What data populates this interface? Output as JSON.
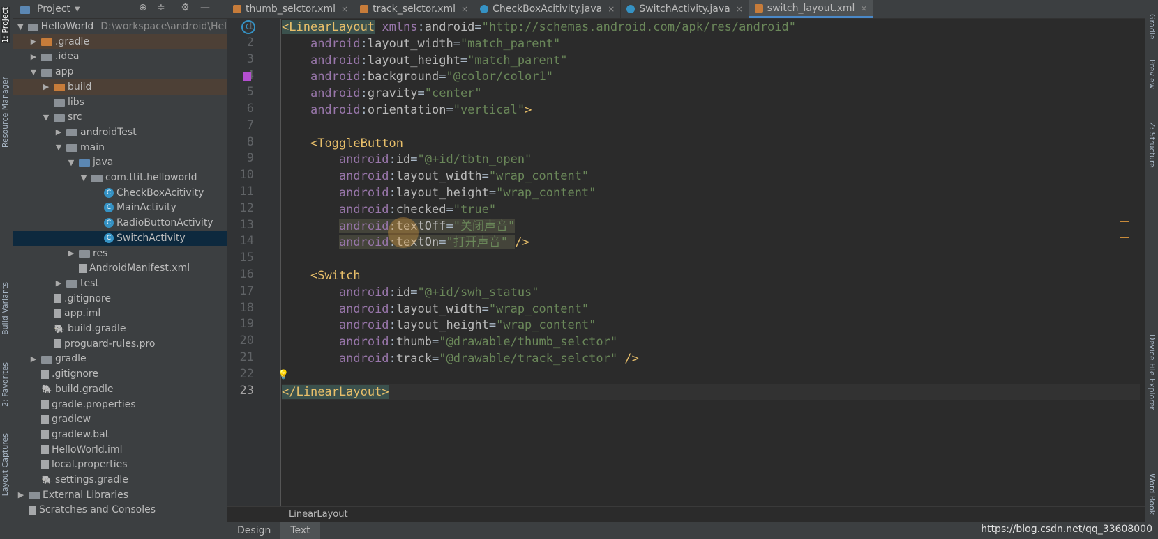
{
  "left_toolbar": [
    "1: Project",
    "Resource Manager",
    "Build Variants",
    "2: Favorites",
    "Layout Captures"
  ],
  "right_toolbar": [
    "Gradle",
    "Preview",
    "Z: Structure",
    "Device File Explorer",
    "Word Book"
  ],
  "project_panel": {
    "title": "Project",
    "tree": [
      {
        "label": "HelloWorld",
        "extra": "D:\\workspace\\android\\Hel",
        "depth": 0,
        "arrow": "down",
        "icon": "module-folder-icon"
      },
      {
        "label": ".gradle",
        "depth": 1,
        "arrow": "right",
        "icon": "folder-icon",
        "state": "excluded"
      },
      {
        "label": ".idea",
        "depth": 1,
        "arrow": "right",
        "icon": "folder-icon"
      },
      {
        "label": "app",
        "depth": 1,
        "arrow": "down",
        "icon": "module-folder-icon"
      },
      {
        "label": "build",
        "depth": 2,
        "arrow": "right",
        "icon": "folder-icon",
        "state": "excluded"
      },
      {
        "label": "libs",
        "depth": 2,
        "arrow": "",
        "icon": "folder-icon"
      },
      {
        "label": "src",
        "depth": 2,
        "arrow": "down",
        "icon": "folder-icon"
      },
      {
        "label": "androidTest",
        "depth": 3,
        "arrow": "right",
        "icon": "folder-icon"
      },
      {
        "label": "main",
        "depth": 3,
        "arrow": "down",
        "icon": "folder-icon"
      },
      {
        "label": "java",
        "depth": 4,
        "arrow": "down",
        "icon": "source-folder-icon"
      },
      {
        "label": "com.ttit.helloworld",
        "depth": 5,
        "arrow": "down",
        "icon": "package-icon"
      },
      {
        "label": "CheckBoxAcitivity",
        "depth": 6,
        "arrow": "",
        "icon": "class-icon"
      },
      {
        "label": "MainActivity",
        "depth": 6,
        "arrow": "",
        "icon": "class-icon"
      },
      {
        "label": "RadioButtonActivity",
        "depth": 6,
        "arrow": "",
        "icon": "class-icon"
      },
      {
        "label": "SwitchActivity",
        "depth": 6,
        "arrow": "",
        "icon": "class-icon",
        "state": "selected"
      },
      {
        "label": "res",
        "depth": 4,
        "arrow": "right",
        "icon": "resource-folder-icon"
      },
      {
        "label": "AndroidManifest.xml",
        "depth": 4,
        "arrow": "",
        "icon": "manifest-file-icon"
      },
      {
        "label": "test",
        "depth": 3,
        "arrow": "right",
        "icon": "folder-icon"
      },
      {
        "label": ".gitignore",
        "depth": 2,
        "arrow": "",
        "icon": "text-file-icon"
      },
      {
        "label": "app.iml",
        "depth": 2,
        "arrow": "",
        "icon": "iml-file-icon"
      },
      {
        "label": "build.gradle",
        "depth": 2,
        "arrow": "",
        "icon": "gradle-file-icon"
      },
      {
        "label": "proguard-rules.pro",
        "depth": 2,
        "arrow": "",
        "icon": "text-file-icon"
      },
      {
        "label": "gradle",
        "depth": 1,
        "arrow": "right",
        "icon": "folder-icon"
      },
      {
        "label": ".gitignore",
        "depth": 1,
        "arrow": "",
        "icon": "text-file-icon"
      },
      {
        "label": "build.gradle",
        "depth": 1,
        "arrow": "",
        "icon": "gradle-file-icon"
      },
      {
        "label": "gradle.properties",
        "depth": 1,
        "arrow": "",
        "icon": "properties-file-icon"
      },
      {
        "label": "gradlew",
        "depth": 1,
        "arrow": "",
        "icon": "text-file-icon"
      },
      {
        "label": "gradlew.bat",
        "depth": 1,
        "arrow": "",
        "icon": "text-file-icon"
      },
      {
        "label": "HelloWorld.iml",
        "depth": 1,
        "arrow": "",
        "icon": "iml-file-icon"
      },
      {
        "label": "local.properties",
        "depth": 1,
        "arrow": "",
        "icon": "properties-file-icon"
      },
      {
        "label": "settings.gradle",
        "depth": 1,
        "arrow": "",
        "icon": "gradle-file-icon"
      },
      {
        "label": "External Libraries",
        "depth": 0,
        "arrow": "right",
        "icon": "library-icon"
      },
      {
        "label": "Scratches and Consoles",
        "depth": 0,
        "arrow": "",
        "icon": "scratch-icon"
      }
    ]
  },
  "tabs": [
    {
      "label": "thumb_selctor.xml",
      "icon": "xml-file-icon",
      "color": "#c77c3a",
      "active": false
    },
    {
      "label": "track_selctor.xml",
      "icon": "xml-file-icon",
      "color": "#c77c3a",
      "active": false
    },
    {
      "label": "CheckBoxAcitivity.java",
      "icon": "class-icon",
      "color": "#3592c4",
      "active": false
    },
    {
      "label": "SwitchActivity.java",
      "icon": "class-icon",
      "color": "#3592c4",
      "active": false
    },
    {
      "label": "switch_layout.xml",
      "icon": "xml-file-icon",
      "color": "#c77c3a",
      "active": true
    }
  ],
  "editor": {
    "lines": [
      [
        [
          "punc",
          "<"
        ],
        [
          "tag",
          "LinearLayout"
        ],
        [
          "plain",
          " "
        ],
        [
          "ns",
          "xmlns"
        ],
        [
          "plain",
          ":"
        ],
        [
          "attr",
          "android"
        ],
        [
          "plain",
          "="
        ],
        [
          "str",
          "\"http://schemas.android.com/apk/res/android\""
        ]
      ],
      [
        [
          "plain",
          "    "
        ],
        [
          "ns",
          "android"
        ],
        [
          "plain",
          ":"
        ],
        [
          "attr",
          "layout_width"
        ],
        [
          "plain",
          "="
        ],
        [
          "str",
          "\"match_parent\""
        ]
      ],
      [
        [
          "plain",
          "    "
        ],
        [
          "ns",
          "android"
        ],
        [
          "plain",
          ":"
        ],
        [
          "attr",
          "layout_height"
        ],
        [
          "plain",
          "="
        ],
        [
          "str",
          "\"match_parent\""
        ]
      ],
      [
        [
          "plain",
          "    "
        ],
        [
          "ns",
          "android"
        ],
        [
          "plain",
          ":"
        ],
        [
          "attr",
          "background"
        ],
        [
          "plain",
          "="
        ],
        [
          "str",
          "\"@color/color1\""
        ]
      ],
      [
        [
          "plain",
          "    "
        ],
        [
          "ns",
          "android"
        ],
        [
          "plain",
          ":"
        ],
        [
          "attr",
          "gravity"
        ],
        [
          "plain",
          "="
        ],
        [
          "str",
          "\"center\""
        ]
      ],
      [
        [
          "plain",
          "    "
        ],
        [
          "ns",
          "android"
        ],
        [
          "plain",
          ":"
        ],
        [
          "attr",
          "orientation"
        ],
        [
          "plain",
          "="
        ],
        [
          "str",
          "\"vertical\""
        ],
        [
          "punc",
          ">"
        ]
      ],
      [],
      [
        [
          "plain",
          "    "
        ],
        [
          "punc",
          "<"
        ],
        [
          "tag",
          "ToggleButton"
        ]
      ],
      [
        [
          "plain",
          "        "
        ],
        [
          "ns",
          "android"
        ],
        [
          "plain",
          ":"
        ],
        [
          "attr",
          "id"
        ],
        [
          "plain",
          "="
        ],
        [
          "str",
          "\"@+id/tbtn_open\""
        ]
      ],
      [
        [
          "plain",
          "        "
        ],
        [
          "ns",
          "android"
        ],
        [
          "plain",
          ":"
        ],
        [
          "attr",
          "layout_width"
        ],
        [
          "plain",
          "="
        ],
        [
          "str",
          "\"wrap_content\""
        ]
      ],
      [
        [
          "plain",
          "        "
        ],
        [
          "ns",
          "android"
        ],
        [
          "plain",
          ":"
        ],
        [
          "attr",
          "layout_height"
        ],
        [
          "plain",
          "="
        ],
        [
          "str",
          "\"wrap_content\""
        ]
      ],
      [
        [
          "plain",
          "        "
        ],
        [
          "ns",
          "android"
        ],
        [
          "plain",
          ":"
        ],
        [
          "attr",
          "checked"
        ],
        [
          "plain",
          "="
        ],
        [
          "str",
          "\"true\""
        ]
      ],
      [
        [
          "plain",
          "        "
        ],
        [
          "ns",
          "android"
        ],
        [
          "plain",
          ":"
        ],
        [
          "attr",
          "textOff"
        ],
        [
          "plain",
          "="
        ],
        [
          "str",
          "\"关闭声音\""
        ]
      ],
      [
        [
          "plain",
          "        "
        ],
        [
          "ns",
          "android"
        ],
        [
          "plain",
          ":"
        ],
        [
          "attr",
          "textOn"
        ],
        [
          "plain",
          "="
        ],
        [
          "str",
          "\"打开声音\""
        ],
        [
          "plain",
          " "
        ],
        [
          "punc",
          "/>"
        ]
      ],
      [],
      [
        [
          "plain",
          "    "
        ],
        [
          "punc",
          "<"
        ],
        [
          "tag",
          "Switch"
        ]
      ],
      [
        [
          "plain",
          "        "
        ],
        [
          "ns",
          "android"
        ],
        [
          "plain",
          ":"
        ],
        [
          "attr",
          "id"
        ],
        [
          "plain",
          "="
        ],
        [
          "str",
          "\"@+id/swh_status\""
        ]
      ],
      [
        [
          "plain",
          "        "
        ],
        [
          "ns",
          "android"
        ],
        [
          "plain",
          ":"
        ],
        [
          "attr",
          "layout_width"
        ],
        [
          "plain",
          "="
        ],
        [
          "str",
          "\"wrap_content\""
        ]
      ],
      [
        [
          "plain",
          "        "
        ],
        [
          "ns",
          "android"
        ],
        [
          "plain",
          ":"
        ],
        [
          "attr",
          "layout_height"
        ],
        [
          "plain",
          "="
        ],
        [
          "str",
          "\"wrap_content\""
        ]
      ],
      [
        [
          "plain",
          "        "
        ],
        [
          "ns",
          "android"
        ],
        [
          "plain",
          ":"
        ],
        [
          "attr",
          "thumb"
        ],
        [
          "plain",
          "="
        ],
        [
          "str",
          "\"@drawable/thumb_selctor\""
        ]
      ],
      [
        [
          "plain",
          "        "
        ],
        [
          "ns",
          "android"
        ],
        [
          "plain",
          ":"
        ],
        [
          "attr",
          "track"
        ],
        [
          "plain",
          "="
        ],
        [
          "str",
          "\"@drawable/track_selctor\""
        ],
        [
          "plain",
          " "
        ],
        [
          "punc",
          "/>"
        ]
      ],
      [],
      [
        [
          "punc",
          "</"
        ],
        [
          "tag",
          "LinearLayout"
        ],
        [
          "punc",
          ">"
        ]
      ]
    ],
    "current_line": 23
  },
  "breadcrumb": "LinearLayout",
  "bottom_tabs": [
    "Design",
    "Text"
  ],
  "watermark": "https://blog.csdn.net/qq_33608000",
  "colors": {
    "tag": "#e8bf6a",
    "attr": "#bababa",
    "string": "#6a8759",
    "selection": "#0d293e",
    "accent": "#4a88c7"
  }
}
